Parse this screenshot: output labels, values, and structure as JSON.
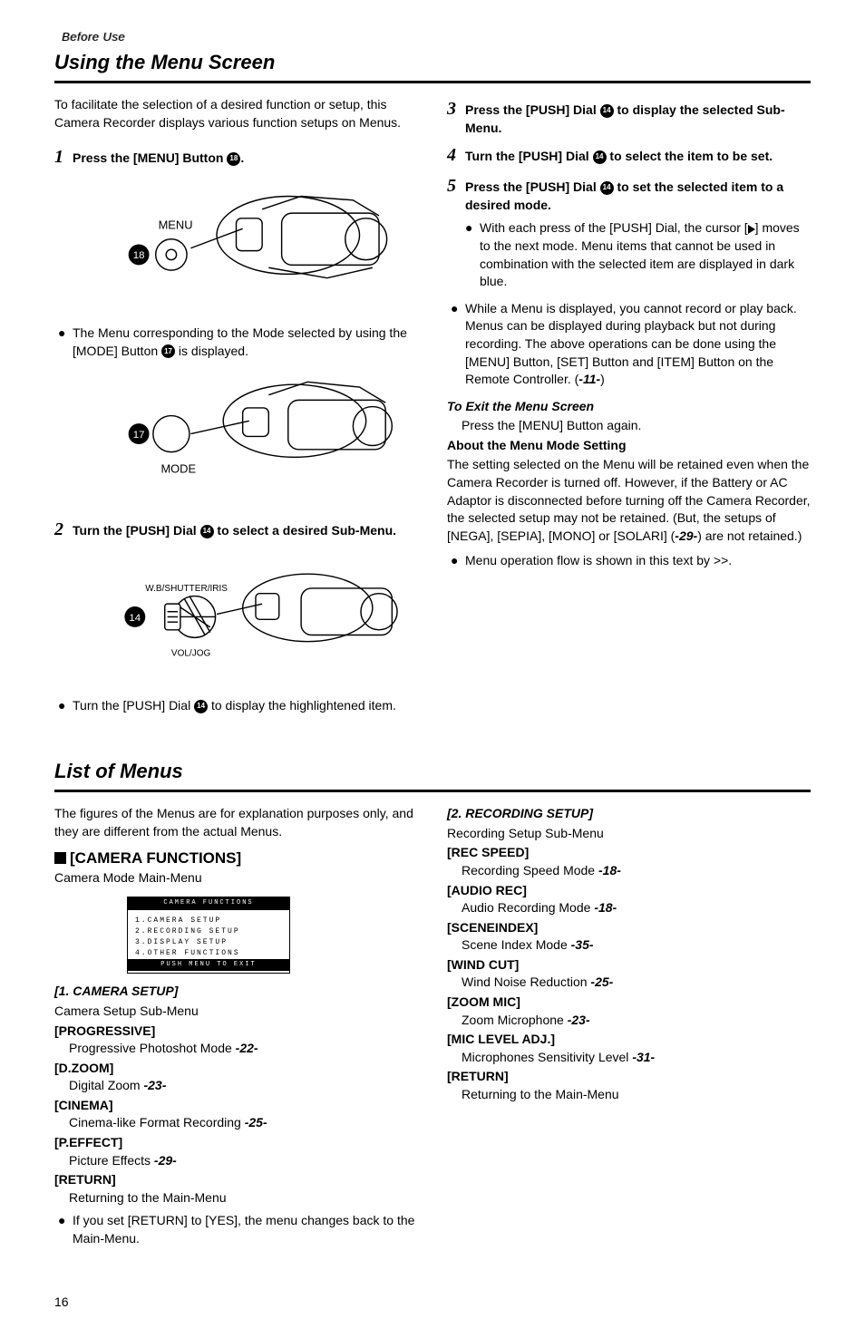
{
  "header": {
    "before_use": "Before Use",
    "title1": "Using the Menu Screen",
    "title2": "List of Menus"
  },
  "intro": "To facilitate the selection of a desired function or setup, this Camera Recorder displays various function setups on Menus.",
  "steps": {
    "s1": "Press the [MENU] Button ",
    "s1_after": ".",
    "s1_bullet": "The Menu corresponding to the Mode selected by using the [MODE] Button ",
    "s1_bullet_after": " is displayed.",
    "s2": "Turn the [PUSH] Dial ",
    "s2_after": " to select a desired Sub-Menu.",
    "s2_bullet": "Turn the [PUSH] Dial ",
    "s2_bullet_after": " to display the highlightened item.",
    "s3": "Press the [PUSH] Dial ",
    "s3_after": " to display the selected Sub-Menu.",
    "s4": "Turn the [PUSH] Dial ",
    "s4_after": " to select the item to be set.",
    "s5": "Press the [PUSH] Dial ",
    "s5_after": " to set the selected item to a desired mode.",
    "s5_bullet_pre": "With each press of the [PUSH] Dial, the cursor [",
    "s5_bullet_post": "] moves to the next mode. Menu items that cannot be used in combination with the selected item are displayed in dark blue.",
    "note_bullet": "While a Menu is displayed, you cannot record or play back. Menus can be displayed during playback but not during recording. The above operations can be done using the [MENU] Button, [SET] Button and [ITEM] Button on the Remote Controller. (",
    "note_bullet_ref": "-11-",
    "note_bullet_post": ")",
    "exit_head": "To Exit the Menu Screen",
    "exit_body": "Press the [MENU] Button again.",
    "about_head": "About the Menu Mode Setting",
    "about_body": "The setting selected on the Menu will be retained even when the Camera Recorder is turned off. However, if the Battery or AC Adaptor is disconnected before turning off the Camera Recorder, the selected setup may not be retained. (But, the setups of [NEGA], [SEPIA], [MONO] or [SOLARI] (",
    "about_ref": "-29-",
    "about_post": ") are not retained.)",
    "flow_bullet": "Menu operation flow is shown in this text by >>."
  },
  "fig_labels": {
    "menu": "MENU",
    "mode": "MODE",
    "wb": "W.B/SHUTTER/IRIS",
    "vol": "VOL/JOG"
  },
  "nums": {
    "n18": "18",
    "n17": "17",
    "n14": "14"
  },
  "list_intro": "The figures of the Menus are for explanation purposes only, and they are different from the actual Menus.",
  "cam_func_head": "[CAMERA FUNCTIONS]",
  "cam_func_sub": "Camera Mode Main-Menu",
  "menu_screen": {
    "title": "CAMERA FUNCTIONS",
    "l1": "1.CAMERA SETUP",
    "l2": "2.RECORDING SETUP",
    "l3": "3.DISPLAY SETUP",
    "l4": "4.OTHER FUNCTIONS",
    "footer": "PUSH MENU TO EXIT"
  },
  "camera_setup": {
    "title": "[1. CAMERA SETUP]",
    "sub": "Camera Setup Sub-Menu",
    "items": [
      {
        "h": "[PROGRESSIVE]",
        "d": "Progressive Photoshot Mode ",
        "r": "-22-"
      },
      {
        "h": "[D.ZOOM]",
        "d": "Digital Zoom ",
        "r": "-23-"
      },
      {
        "h": "[CINEMA]",
        "d": "Cinema-like Format Recording ",
        "r": "-25-"
      },
      {
        "h": "[P.EFFECT]",
        "d": "Picture Effects ",
        "r": "-29-"
      }
    ],
    "return_h": "[RETURN]",
    "return_d": "Returning to the Main-Menu",
    "return_bullet": "If you set [RETURN] to [YES], the menu changes back to the Main-Menu."
  },
  "recording_setup": {
    "title": "[2. RECORDING SETUP]",
    "sub": "Recording Setup Sub-Menu",
    "items": [
      {
        "h": "[REC SPEED]",
        "d": "Recording Speed Mode ",
        "r": "-18-"
      },
      {
        "h": "[AUDIO REC]",
        "d": "Audio Recording Mode ",
        "r": "-18-"
      },
      {
        "h": "[SCENEINDEX]",
        "d": "Scene Index Mode ",
        "r": "-35-"
      },
      {
        "h": "[WIND CUT]",
        "d": "Wind Noise Reduction ",
        "r": "-25-"
      },
      {
        "h": "[ZOOM MIC]",
        "d": "Zoom Microphone ",
        "r": "-23-"
      },
      {
        "h": "[MIC LEVEL ADJ.]",
        "d": "Microphones Sensitivity Level ",
        "r": "-31-"
      }
    ],
    "return_h": "[RETURN]",
    "return_d": "Returning to the Main-Menu"
  },
  "page_num": "16"
}
